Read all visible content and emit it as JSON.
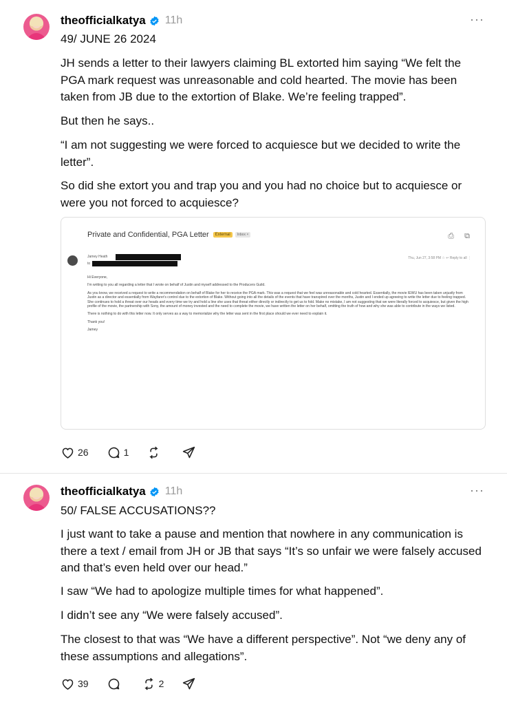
{
  "posts": [
    {
      "username": "theofficialkatya",
      "time": "11h",
      "more": "···",
      "title": "49/ JUNE 26 2024",
      "paragraphs": [
        "JH sends a letter to their lawyers claiming BL extorted him saying “We felt the PGA mark request was unreasonable and cold hearted. The movie has been taken from JB due to the extortion of Blake. We’re feeling trapped”.",
        "But then he says..",
        "“I am not suggesting we were forced to acquiesce but we decided to write the letter”.",
        "So did she extort you and trap you and you had no choice but to acquiesce or were you not forced to acquiesce?"
      ],
      "likes": "26",
      "replies": "1",
      "reposts": "",
      "letter": {
        "subject": "Private and Confidential, PGA Letter",
        "badge": "External",
        "inbox": "Inbox ×",
        "icons": "⎙ ⧉",
        "sender": "Jamey Heath",
        "to": "to",
        "meta": "Thu, Jun 27, 3:58 PM   ☆   ↩  Reply to all   ⋮",
        "body": [
          "Hi Everyone,",
          "I'm writing to you all regarding a letter that I wrote on behalf of Justin and myself addressed to the Producers Guild.",
          "As you know, we received a request to write a recommendation on behalf of Blake for her to receive the PGA mark. This was a request that we feel was unreasonable and cold hearted. Essentially, the movie IEWU has been taken unjustly from Justin as a director and essentially from Wayfarer's control due to the extortion of Blake. Without going into all the details of the events that have transpired over the months, Justin and I ended up agreeing to write the letter due to feeling trapped. She continues to hold a threat over our heads and every time we try and hold a line she uses that threat either directly or indirectly to get us to fold. Make no mistake, I am not suggesting that we were literally forced to acquiesce, but given the high profile of the movie, the partnership with Sony, the amount of money invested and the need to complete the movie, we have written the letter on her behalf, omitting the truth of how and why she was able to contribute in the ways we listed.",
          "There is nothing to do with this letter now. It only serves as a way to memorialize why the letter was sent in the first place should we ever need to explain it.",
          "Thank you!",
          "Jamey"
        ]
      }
    },
    {
      "username": "theofficialkatya",
      "time": "11h",
      "more": "···",
      "title": "50/ FALSE ACCUSATIONS??",
      "paragraphs": [
        "I just want to take a pause and mention that nowhere in any communication is there a text / email from JH or JB that says “It’s so unfair we were falsely accused and that’s even held over our head.”",
        "I saw “We had to apologize multiple times for what happened”.",
        "I didn’t see any “We were falsely accused”.",
        "The closest to that was “We have a different perspective”. Not “we deny any of these assumptions and allegations”."
      ],
      "likes": "39",
      "replies": "",
      "reposts": "2"
    }
  ],
  "icons": {
    "verified": "verified-badge-icon",
    "like": "heart-icon",
    "reply": "comment-icon",
    "repost": "repost-icon",
    "share": "send-icon"
  },
  "colors": {
    "verified": "#0095f6",
    "muted": "#9a9a9a"
  }
}
